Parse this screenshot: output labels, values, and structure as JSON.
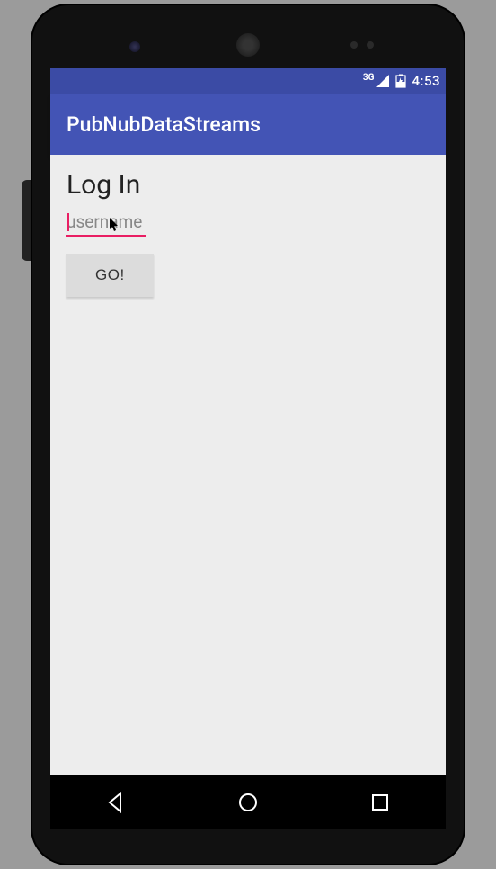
{
  "status": {
    "network_label": "3G",
    "time": "4:53"
  },
  "app": {
    "title": "PubNubDataStreams"
  },
  "login": {
    "heading": "Log In",
    "username_placeholder": "username",
    "username_value": "",
    "go_button": "GO!"
  }
}
